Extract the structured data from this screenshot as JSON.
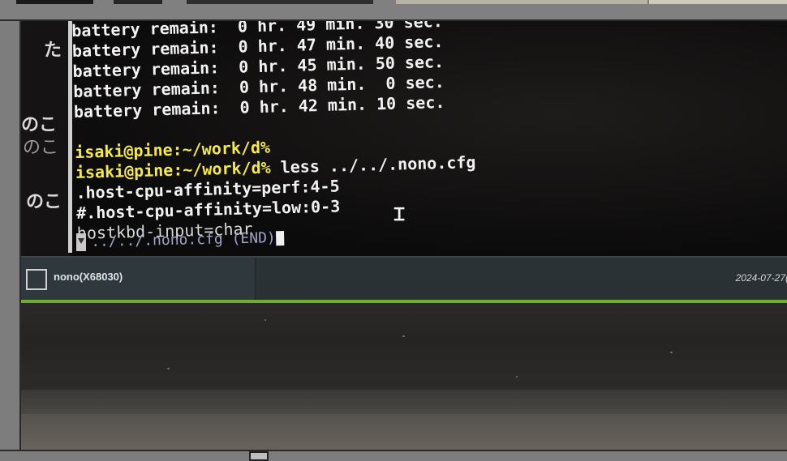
{
  "terminal": {
    "lines": [
      {
        "text": "battery remain:  0 hr. 49 min. 30 sec.",
        "color": "white"
      },
      {
        "text": "battery remain:  0 hr. 47 min. 40 sec.",
        "color": "white"
      },
      {
        "text": "battery remain:  0 hr. 45 min. 50 sec.",
        "color": "white"
      },
      {
        "text": "battery remain:  0 hr. 48 min.  0 sec.",
        "color": "white"
      },
      {
        "text": "battery remain:  0 hr. 42 min. 10 sec.",
        "color": "white"
      },
      {
        "text": "",
        "color": "white"
      },
      {
        "text": "isaki@pine:~/work/d%",
        "color": "yellow"
      },
      {
        "text": "isaki@pine:~/work/d% less ../../.nono.cfg",
        "color": "yellow"
      },
      {
        "text": ".host-cpu-affinity=perf:4-5",
        "color": "white"
      },
      {
        "text": "#.host-cpu-affinity=low:0-3",
        "color": "white"
      },
      {
        "text": "hostkbd-input=char",
        "color": "dim"
      }
    ],
    "prompt": "isaki@pine:~/work/d%",
    "command": " less ../../.nono.cfg",
    "status_line": "../../.nono.cfg (END)"
  },
  "background_glyphs": [
    "た",
    "のこ",
    "のこ",
    "のこ"
  ],
  "taskbar": {
    "window_label": "nono(X68030)",
    "clock": "2024-07-27("
  },
  "colors": {
    "prompt": "#f5e94a",
    "text": "#f2f2f2",
    "status": "#9fa4c8",
    "taskbar": "#2b3236",
    "accent_green": "#6fae2c"
  },
  "icons": {
    "window_icon": "window-frame-icon",
    "text_cursor": "i-beam-cursor-icon",
    "scroll_arrow": "triangle-down-icon"
  }
}
